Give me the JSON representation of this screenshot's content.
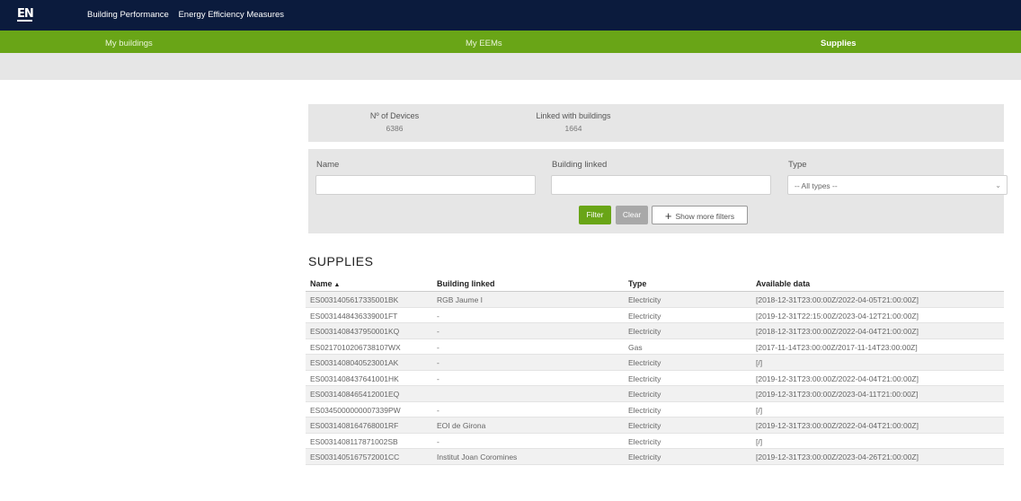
{
  "app": {
    "logo_text": "EN",
    "top_nav": [
      "Building Performance",
      "Energy Efficiency Measures"
    ]
  },
  "tabs": [
    {
      "label": "My buildings",
      "active": false
    },
    {
      "label": "My EEMs",
      "active": false
    },
    {
      "label": "Supplies",
      "active": true
    }
  ],
  "stats": {
    "devices_label": "Nº of Devices",
    "devices_value": "6386",
    "linked_label": "Linked with buildings",
    "linked_value": "1664"
  },
  "filters": {
    "name_label": "Name",
    "name_value": "",
    "building_label": "Building linked",
    "building_value": "",
    "type_label": "Type",
    "type_selected": "-- All types --",
    "filter_button": "Filter",
    "clear_button": "Clear",
    "more_button": "Show more filters"
  },
  "supplies": {
    "title": "SUPPLIES",
    "columns": [
      "Name",
      "Building linked",
      "Type",
      "Available data"
    ],
    "sort_indicator": "▲",
    "rows": [
      [
        "ES0031405617335001BK",
        "RGB Jaume I",
        "Electricity",
        "[2018-12-31T23:00:00Z/2022-04-05T21:00:00Z]"
      ],
      [
        "ES0031448436339001FT",
        "-",
        "Electricity",
        "[2019-12-31T22:15:00Z/2023-04-12T21:00:00Z]"
      ],
      [
        "ES0031408437950001KQ",
        "-",
        "Electricity",
        "[2018-12-31T23:00:00Z/2022-04-04T21:00:00Z]"
      ],
      [
        "ES0217010206738107WX",
        "-",
        "Gas",
        "[2017-11-14T23:00:00Z/2017-11-14T23:00:00Z]"
      ],
      [
        "ES0031408040523001AK",
        "-",
        "Electricity",
        "[/]"
      ],
      [
        "ES0031408437641001HK",
        "-",
        "Electricity",
        "[2019-12-31T23:00:00Z/2022-04-04T21:00:00Z]"
      ],
      [
        "ES0031408465412001EQ",
        "",
        "Electricity",
        "[2019-12-31T23:00:00Z/2023-04-11T21:00:00Z]"
      ],
      [
        "ES0345000000007339PW",
        "-",
        "Electricity",
        "[/]"
      ],
      [
        "ES0031408164768001RF",
        "EOI de Girona",
        "Electricity",
        "[2019-12-31T23:00:00Z/2022-04-04T21:00:00Z]"
      ],
      [
        "ES0031408117871002SB",
        "-",
        "Electricity",
        "[/]"
      ],
      [
        "ES0031405167572001CC",
        "Institut Joan Coromines",
        "Electricity",
        "[2019-12-31T23:00:00Z/2023-04-26T21:00:00Z]"
      ]
    ]
  }
}
